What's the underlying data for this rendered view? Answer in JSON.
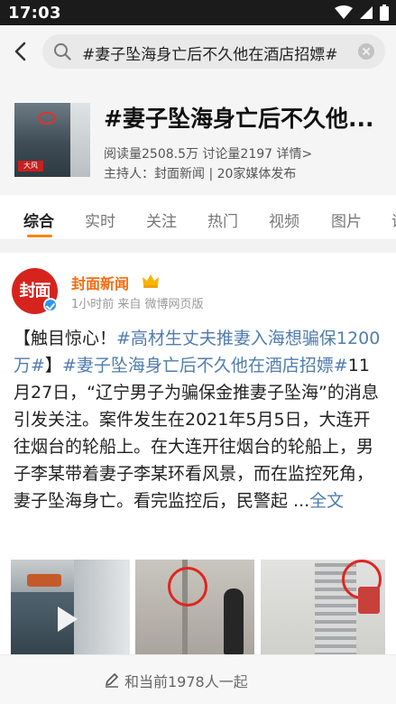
{
  "status_bar": {
    "time": "17:03",
    "icons": [
      "wifi-icon",
      "signal-icon",
      "battery-icon"
    ]
  },
  "search": {
    "query": "#妻子坠海身亡后不久他在酒店招嫖#"
  },
  "topic": {
    "title": "#妻子坠海身亡后不久他...",
    "stats": "阅读量2508.5万 讨论量2197 详情>",
    "host": "主持人：封面新闻 | 20家媒体发布",
    "thumb_tag": "大风"
  },
  "tabs": [
    {
      "label": "综合",
      "active": true
    },
    {
      "label": "实时",
      "active": false
    },
    {
      "label": "关注",
      "active": false
    },
    {
      "label": "热门",
      "active": false
    },
    {
      "label": "视频",
      "active": false
    },
    {
      "label": "图片",
      "active": false
    },
    {
      "label": "话",
      "active": false
    }
  ],
  "post": {
    "avatar_text": "封面",
    "author": "封面新闻",
    "meta": "1小时前 来自 微博网页版",
    "content": {
      "part1": "【触目惊心！",
      "link1": "#高材生丈夫推妻入海想骗保1200万#",
      "part2": "】",
      "link2": "#妻子坠海身亡后不久他在酒店招嫖#",
      "part3": "11月27日，“辽宁男子为骗保金推妻子坠海”的消息引发关注。案件发生在2021年5月5日，大连开往烟台的轮船上。在大连开往烟台的轮船上，男子李某带着妻子李某环看风景，而在监控死角，妻子坠海身亡。看完监控后，民警起 ...",
      "more": "全文"
    }
  },
  "bottom_bar": {
    "label": "和当前1978人一起"
  },
  "colors": {
    "accent": "#ff8200",
    "link": "#507daf",
    "author": "#f86b0f"
  }
}
